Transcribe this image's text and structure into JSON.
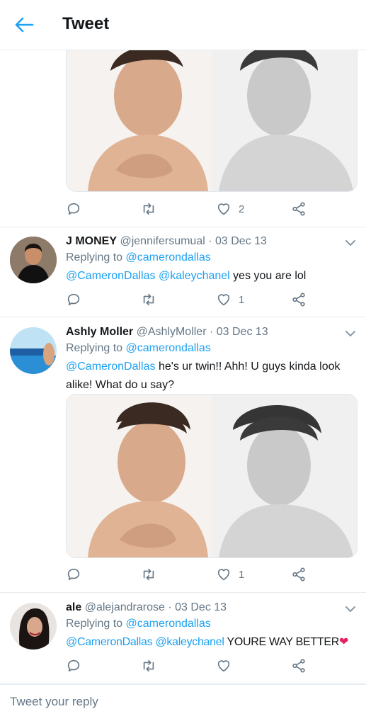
{
  "header": {
    "title": "Tweet"
  },
  "tweets": [
    {
      "stats": {
        "reply": "",
        "retweet": "",
        "like": "2",
        "share": ""
      }
    },
    {
      "name": "J MONEY",
      "handle": "@jennifersumual",
      "date": "· 03 Dec 13",
      "replying_prefix": "Replying to",
      "replying_handle": "@camerondallas",
      "mention1": "@CameronDallas",
      "mention2": "@kaleychanel",
      "text": "yes you are lol",
      "stats": {
        "like": "1"
      }
    },
    {
      "name": "Ashly Moller",
      "handle": "@AshlyMoller",
      "date": "· 03 Dec 13",
      "replying_prefix": "Replying to",
      "replying_handle": "@camerondallas",
      "mention1": "@CameronDallas",
      "text": "he's ur twin!! Ahh! U guys kinda look alike! What do u say?",
      "stats": {
        "like": "1"
      }
    },
    {
      "name": "ale",
      "handle": "@alejandrarose",
      "date": "· 03 Dec 13",
      "replying_prefix": "Replying to",
      "replying_handle": "@camerondallas",
      "mention1": "@CameronDallas",
      "mention2": "@kaleychanel",
      "text": "YOURE WAY BETTER",
      "emoji": "❤",
      "stats": {
        "like": ""
      }
    }
  ],
  "reply": {
    "placeholder": "Tweet your reply"
  },
  "colors": {
    "accent": "#1da1f2",
    "secondary_text": "#657786",
    "heart_emoji": "#e0245e"
  }
}
